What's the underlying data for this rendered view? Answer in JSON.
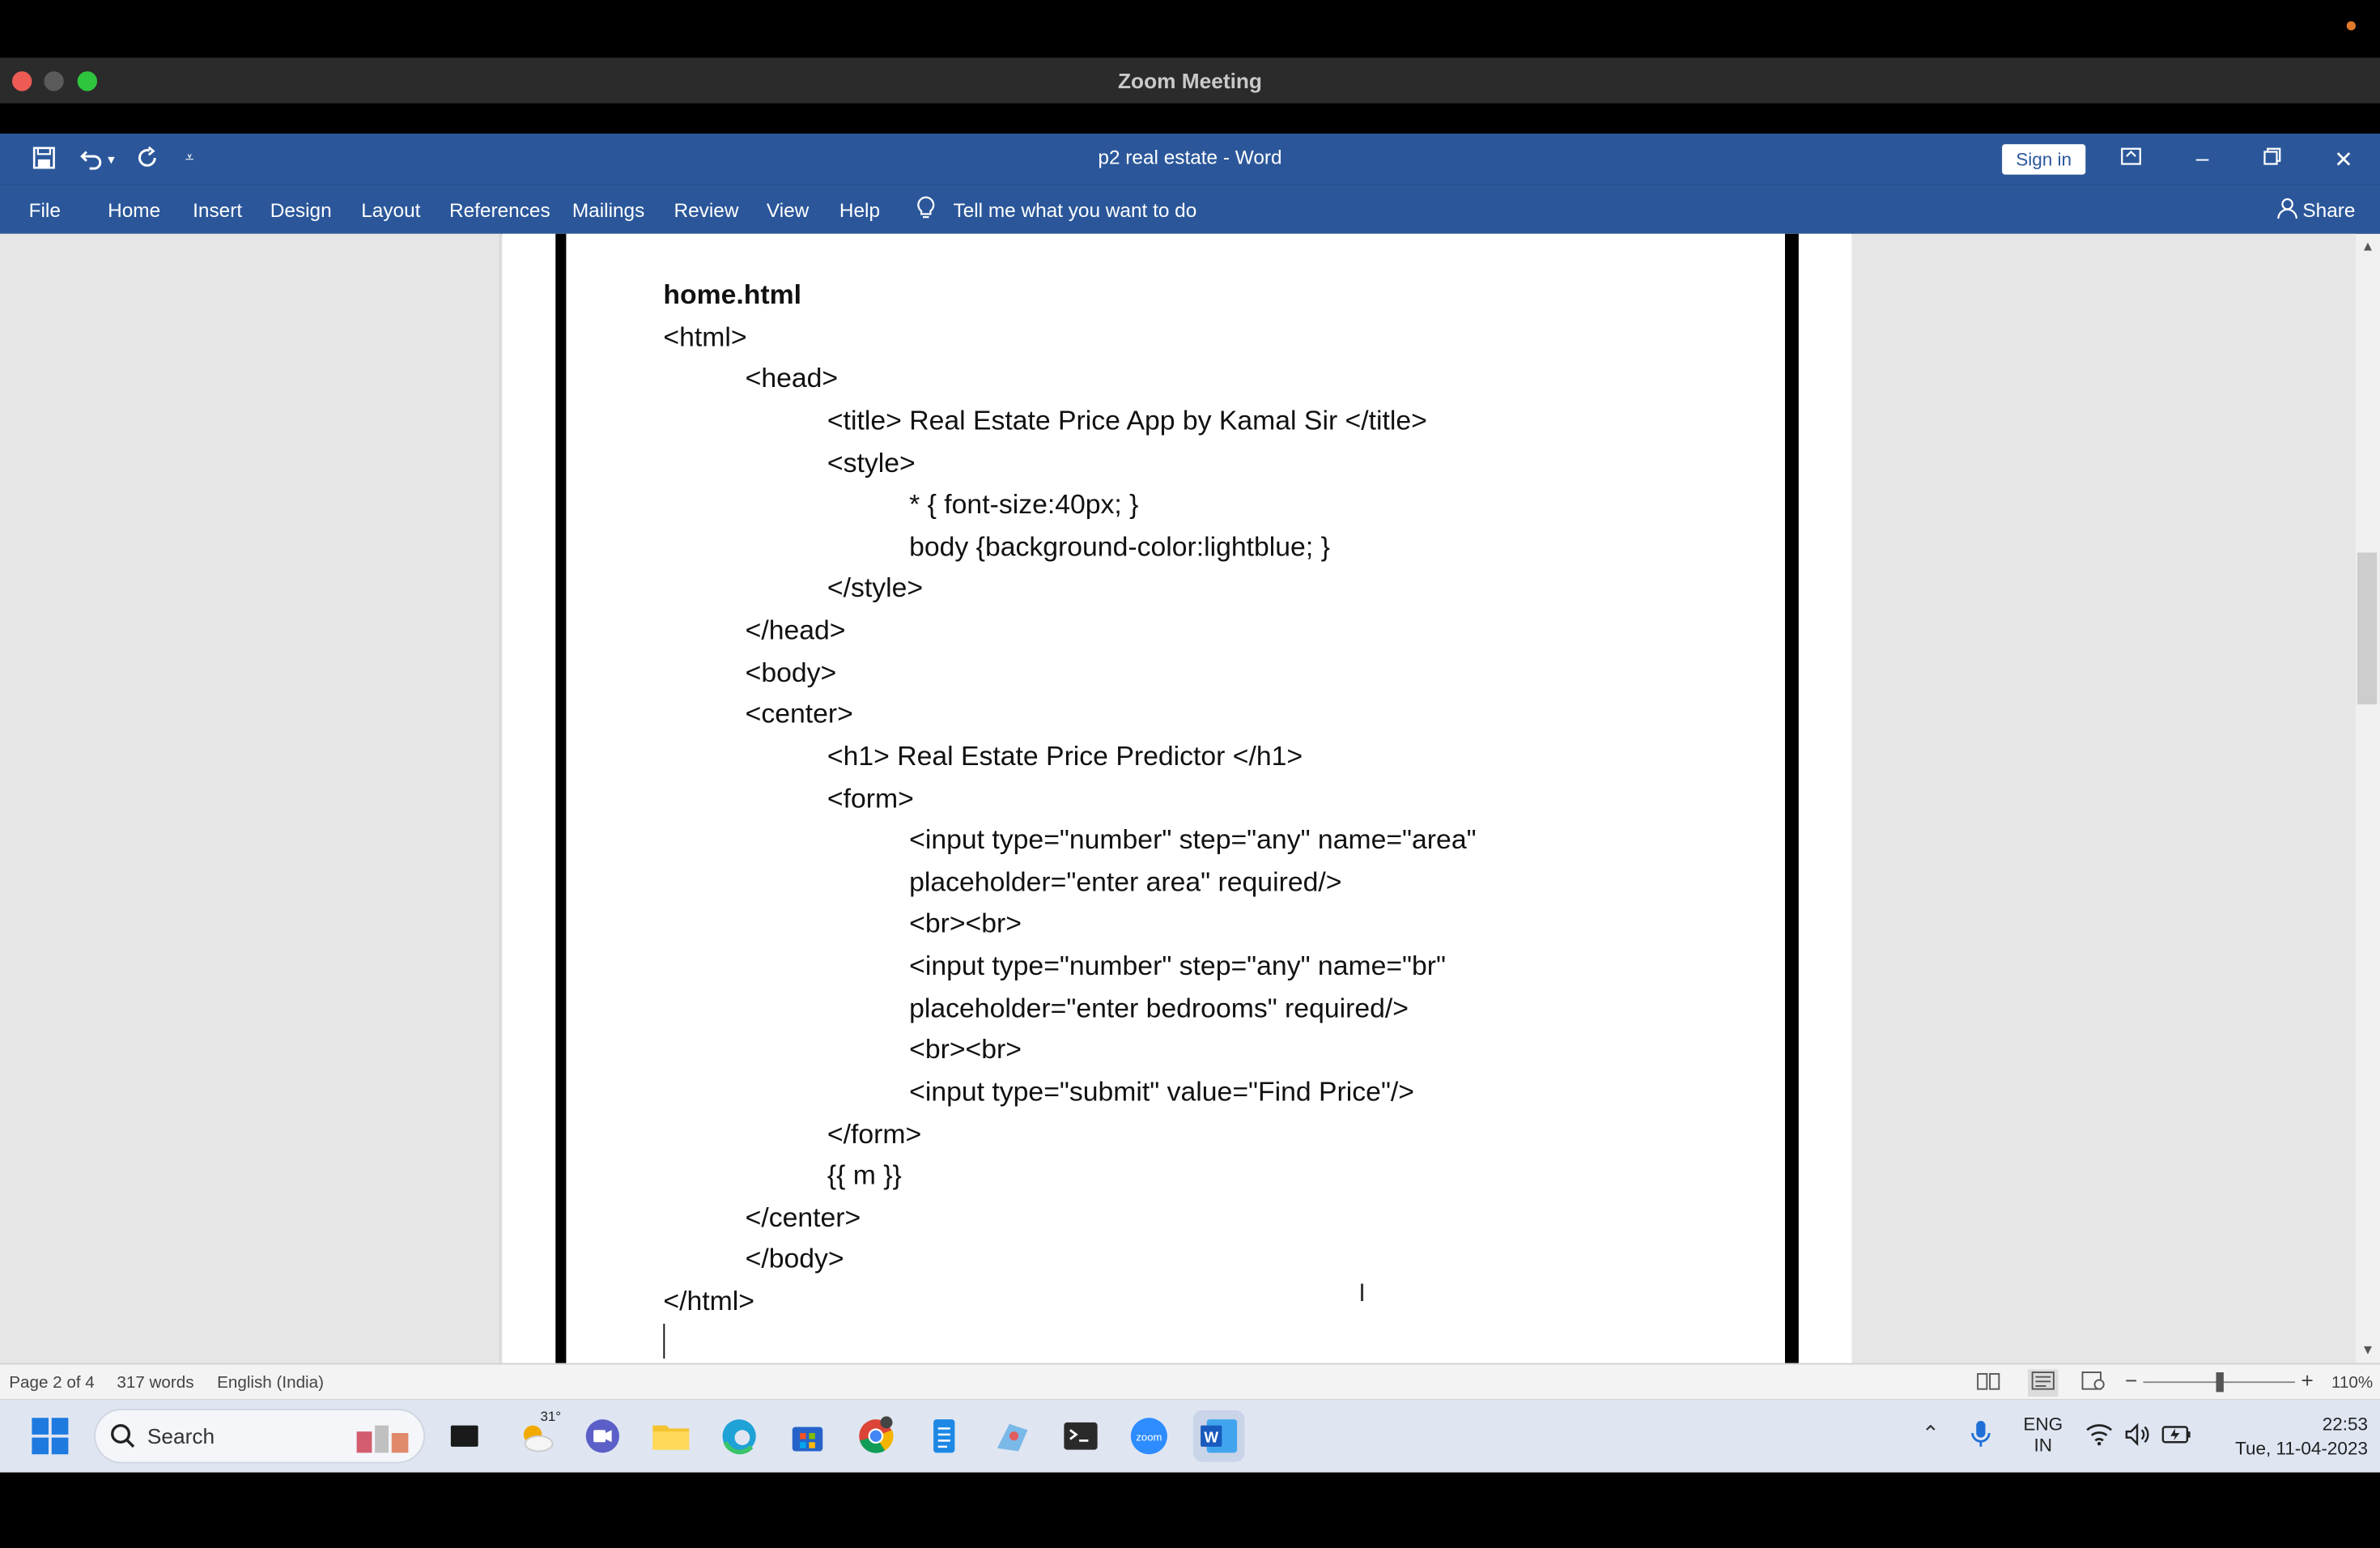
{
  "zoom": {
    "window_title": "Zoom Meeting"
  },
  "word": {
    "doc_title": "p2 real estate  -  Word",
    "sign_in": "Sign in",
    "tabs": [
      "File",
      "Home",
      "Insert",
      "Design",
      "Layout",
      "References",
      "Mailings",
      "Review",
      "View",
      "Help"
    ],
    "tell_me": "Tell me what you want to do",
    "share": "Share"
  },
  "document": {
    "heading": "home.html",
    "lines": [
      "<html>",
      "<head>",
      "<title> Real Estate Price App by Kamal Sir </title>",
      "<style>",
      "* { font-size:40px; }",
      "body {background-color:lightblue; }",
      "</style>",
      "</head>",
      "<body>",
      "<center>",
      "<h1> Real Estate Price Predictor </h1>",
      "<form>",
      "<input type=\"number\" step=\"any\" name=\"area\"",
      "placeholder=\"enter area\" required/>",
      "<br><br>",
      "<input type=\"number\" step=\"any\" name=\"br\"",
      "placeholder=\"enter bedrooms\" required/>",
      "<br><br>",
      "<input type=\"submit\" value=\"Find Price\"/>",
      "</form>",
      "{{ m }}",
      "</center>",
      "</body>",
      "</html>"
    ]
  },
  "status": {
    "page": "Page 2 of 4",
    "words": "317 words",
    "language": "English (India)",
    "zoom": "110%"
  },
  "taskbar": {
    "search": "Search",
    "weather": "31°",
    "lang_top": "ENG",
    "lang_bottom": "IN",
    "time": "22:53",
    "date": "Tue, 11-04-2023"
  }
}
